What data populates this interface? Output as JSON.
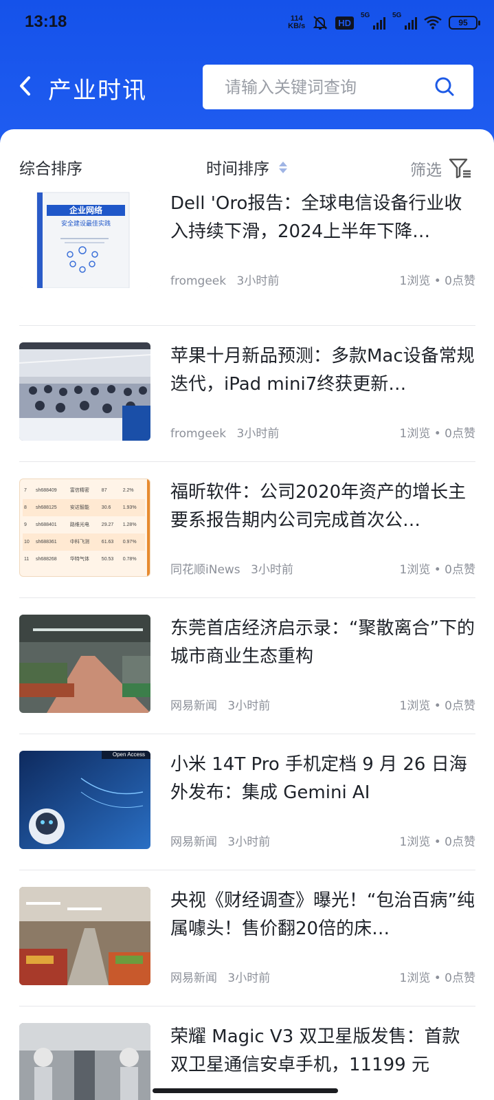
{
  "status_bar": {
    "time": "13:18",
    "net_speed_value": "114",
    "net_speed_unit": "KB/s",
    "hd_badge": "HD",
    "signal_1": "5G",
    "signal_2": "5G",
    "battery": "95",
    "icons": [
      "mute-bell-icon",
      "signal-icon",
      "wifi-icon",
      "battery-icon"
    ]
  },
  "header": {
    "title": "产业时讯",
    "back_icon": "chevron-left-icon",
    "search_placeholder": "请输入关键词查询",
    "search_icon": "search-icon"
  },
  "sort_bar": {
    "comprehensive": "综合排序",
    "time_sort": "时间排序",
    "filter": "筛选",
    "filter_icon": "filter-icon"
  },
  "news": [
    {
      "title": "Dell 'Oro报告：全球电信设备行业收入持续下滑，2024上半年下降…",
      "source": "fromgeek",
      "time": "3小时前",
      "stats": "1浏览 • 0点赞",
      "thumb_text": "企业网络",
      "thumb_sub": "安全建设最佳实践"
    },
    {
      "title": "苹果十月新品预测：多款Mac设备常规迭代，iPad mini7终获更新…",
      "source": "fromgeek",
      "time": "3小时前",
      "stats": "1浏览 • 0点赞"
    },
    {
      "title": "福昕软件：公司2020年资产的增长主要系报告期内公司完成首次公…",
      "source": "同花顺iNews",
      "time": "3小时前",
      "stats": "1浏览 • 0点赞",
      "table_rows": [
        [
          "7",
          "sh688409",
          "富信精密",
          "87",
          "2.2%"
        ],
        [
          "8",
          "sh688125",
          "安达智能",
          "30.6",
          "1.93%"
        ],
        [
          "9",
          "sh688401",
          "路维光电",
          "29.27",
          "1.28%"
        ],
        [
          "10",
          "sh688361",
          "中科飞测",
          "61.63",
          "0.97%"
        ],
        [
          "11",
          "sh688268",
          "华特气体",
          "50.53",
          "0.78%"
        ]
      ]
    },
    {
      "title": "东莞首店经济启示录：“聚散离合”下的城市商业生态重构",
      "source": "网易新闻",
      "time": "3小时前",
      "stats": "1浏览 • 0点赞"
    },
    {
      "title": "小米 14T Pro 手机定档 9 月 26 日海外发布：集成 Gemini AI",
      "source": "网易新闻",
      "time": "3小时前",
      "stats": "1浏览 • 0点赞",
      "thumb_label": "Open Access"
    },
    {
      "title": "央视《财经调查》曝光！“包治百病”纯属噱头！售价翻20倍的床…",
      "source": "网易新闻",
      "time": "3小时前",
      "stats": "1浏览 • 0点赞"
    },
    {
      "title": "荣耀 Magic V3 双卫星版发售：首款双卫星通信安卓手机，11199 元",
      "source": "",
      "time": "",
      "stats": ""
    }
  ]
}
